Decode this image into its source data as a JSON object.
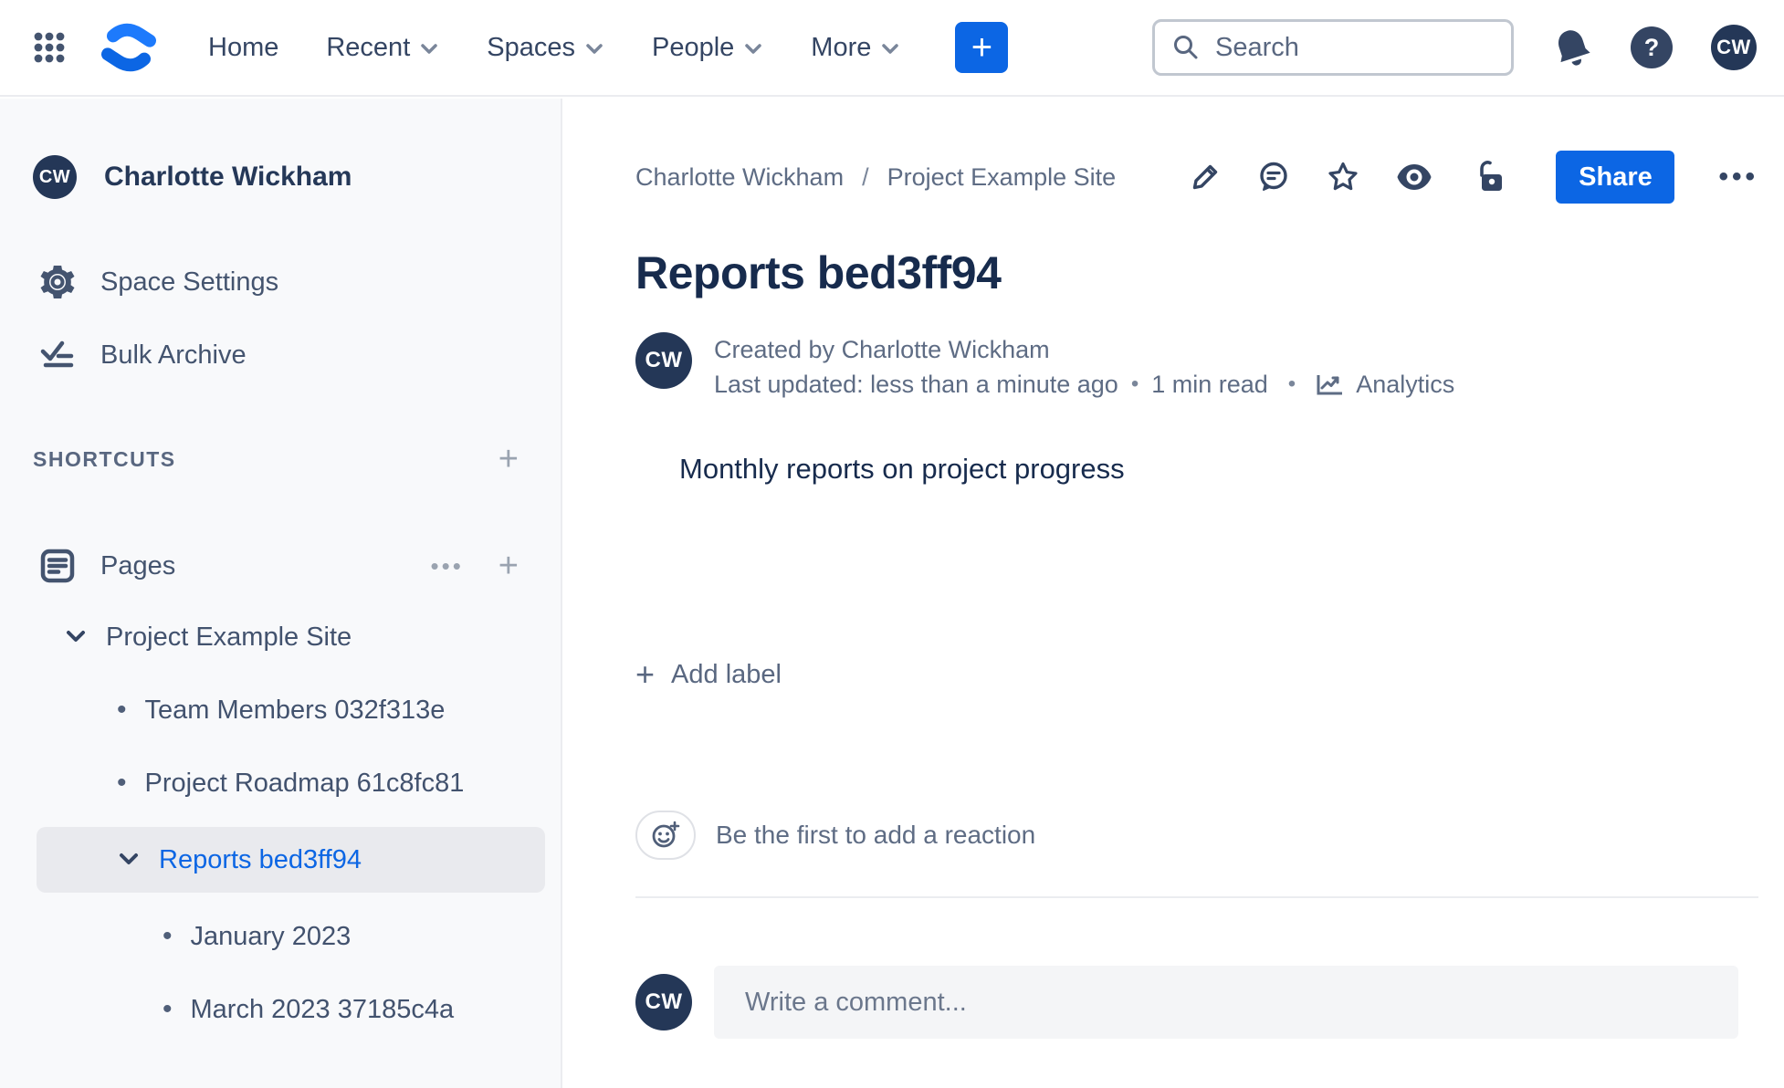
{
  "topnav": {
    "menu": [
      {
        "label": "Home",
        "chevron": false
      },
      {
        "label": "Recent",
        "chevron": true
      },
      {
        "label": "Spaces",
        "chevron": true
      },
      {
        "label": "People",
        "chevron": true
      },
      {
        "label": "More",
        "chevron": true
      }
    ],
    "create_label": "+",
    "search": {
      "placeholder": "Search"
    },
    "help_glyph": "?",
    "avatar_initials": "CW"
  },
  "sidebar": {
    "user": {
      "name": "Charlotte Wickham",
      "initials": "CW"
    },
    "menu": [
      {
        "icon": "gear-icon",
        "label": "Space Settings"
      },
      {
        "icon": "bulk-archive-icon",
        "label": "Bulk Archive"
      }
    ],
    "shortcuts_title": "SHORTCUTS",
    "pages_label": "Pages",
    "tree": [
      {
        "label": "Project Example Site",
        "level": 0,
        "marker": "chevron",
        "selected": false
      },
      {
        "label": "Team Members 032f313e",
        "level": 1,
        "marker": "bullet",
        "selected": false
      },
      {
        "label": "Project Roadmap 61c8fc81",
        "level": 1,
        "marker": "bullet",
        "selected": false
      },
      {
        "label": "Reports bed3ff94",
        "level": 1,
        "marker": "chevron",
        "selected": true
      },
      {
        "label": "January 2023",
        "level": 2,
        "marker": "bullet",
        "selected": false
      },
      {
        "label": "March 2023 37185c4a",
        "level": 2,
        "marker": "bullet",
        "selected": false
      }
    ]
  },
  "content": {
    "breadcrumbs": {
      "0": "Charlotte Wickham",
      "sep": "/",
      "1": "Project Example Site"
    },
    "share_label": "Share",
    "title": "Reports bed3ff94",
    "byline": {
      "avatar_initials": "CW",
      "created": "Created by Charlotte Wickham",
      "updated": "Last updated: less than a minute ago",
      "sep": "•",
      "read_time": "1 min read",
      "analytics_label": "Analytics"
    },
    "body_text": "Monthly reports on project progress",
    "add_label_text": "Add label",
    "reaction_prompt": "Be the first to add a reaction",
    "comment": {
      "avatar_initials": "CW",
      "placeholder": "Write a comment..."
    }
  },
  "icons": {
    "plus": "+",
    "ellipsis": "•••",
    "bullet": "•",
    "more": "•••"
  },
  "colors": {
    "accent_blue": "#0C66E4",
    "avatar_bg": "#243757",
    "icon_navy": "#344563",
    "text_dark": "#172B4D",
    "text_gray": "#5E6C84",
    "sidebar_bg": "#F8F9FB",
    "selected_row_bg": "#E9EAEE",
    "border_gray": "#EBECF0"
  }
}
